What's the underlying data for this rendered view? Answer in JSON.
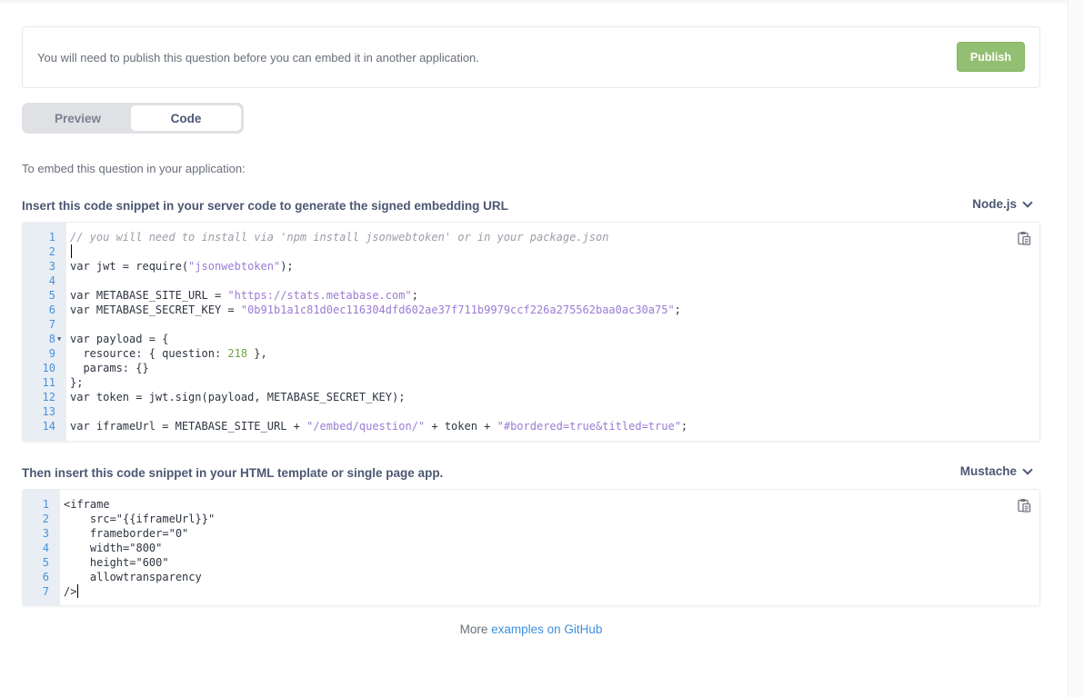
{
  "notice": {
    "text": "You will need to publish this question before you can embed it in another application.",
    "publish_label": "Publish"
  },
  "tabs": [
    {
      "label": "Preview",
      "active": false
    },
    {
      "label": "Code",
      "active": true
    }
  ],
  "embed_intro": "To embed this question in your application:",
  "server_section": {
    "label": "Insert this code snippet in your server code to generate the signed embedding URL",
    "language": "Node.js",
    "lines": [
      {
        "n": "1",
        "tokens": [
          {
            "t": "// you will need to install via 'npm install jsonwebtoken' or in your package.json",
            "c": "comment"
          }
        ]
      },
      {
        "n": "2",
        "tokens": []
      },
      {
        "n": "3",
        "tokens": [
          {
            "t": "var jwt = require(",
            "c": "plain"
          },
          {
            "t": "\"jsonwebtoken\"",
            "c": "string"
          },
          {
            "t": ");",
            "c": "plain"
          }
        ]
      },
      {
        "n": "4",
        "tokens": []
      },
      {
        "n": "5",
        "tokens": [
          {
            "t": "var METABASE_SITE_URL = ",
            "c": "plain"
          },
          {
            "t": "\"https://stats.metabase.com\"",
            "c": "string"
          },
          {
            "t": ";",
            "c": "plain"
          }
        ]
      },
      {
        "n": "6",
        "tokens": [
          {
            "t": "var METABASE_SECRET_KEY = ",
            "c": "plain"
          },
          {
            "t": "\"0b91b1a1c81d0ec116304dfd602ae37f711b9979ccf226a275562baa0ac30a75\"",
            "c": "string"
          },
          {
            "t": ";",
            "c": "plain"
          }
        ]
      },
      {
        "n": "7",
        "tokens": []
      },
      {
        "n": "8",
        "fold": true,
        "tokens": [
          {
            "t": "var payload = {",
            "c": "plain"
          }
        ]
      },
      {
        "n": "9",
        "tokens": [
          {
            "t": "  resource: { question: ",
            "c": "plain"
          },
          {
            "t": "218",
            "c": "number"
          },
          {
            "t": " },",
            "c": "plain"
          }
        ]
      },
      {
        "n": "10",
        "tokens": [
          {
            "t": "  params: {}",
            "c": "plain"
          }
        ]
      },
      {
        "n": "11",
        "tokens": [
          {
            "t": "};",
            "c": "plain"
          }
        ]
      },
      {
        "n": "12",
        "tokens": [
          {
            "t": "var token = jwt.sign(payload, METABASE_SECRET_KEY);",
            "c": "plain"
          }
        ]
      },
      {
        "n": "13",
        "tokens": []
      },
      {
        "n": "14",
        "tokens": [
          {
            "t": "var iframeUrl = METABASE_SITE_URL + ",
            "c": "plain"
          },
          {
            "t": "\"/embed/question/\"",
            "c": "string"
          },
          {
            "t": " + token + ",
            "c": "plain"
          },
          {
            "t": "\"#bordered=true&titled=true\"",
            "c": "string"
          },
          {
            "t": ";",
            "c": "plain"
          }
        ]
      }
    ]
  },
  "client_section": {
    "label": "Then insert this code snippet in your HTML template or single page app.",
    "language": "Mustache",
    "lines": [
      {
        "n": "1",
        "tokens": [
          {
            "t": "<iframe",
            "c": "plain"
          }
        ]
      },
      {
        "n": "2",
        "tokens": [
          {
            "t": "    src=\"{{iframeUrl}}\"",
            "c": "plain"
          }
        ]
      },
      {
        "n": "3",
        "tokens": [
          {
            "t": "    frameborder=\"0\"",
            "c": "plain"
          }
        ]
      },
      {
        "n": "4",
        "tokens": [
          {
            "t": "    width=\"800\"",
            "c": "plain"
          }
        ]
      },
      {
        "n": "5",
        "tokens": [
          {
            "t": "    height=\"600\"",
            "c": "plain"
          }
        ]
      },
      {
        "n": "6",
        "tokens": [
          {
            "t": "    allowtransparency",
            "c": "plain"
          }
        ]
      },
      {
        "n": "7",
        "tokens": [
          {
            "t": "/>",
            "c": "plain"
          }
        ]
      }
    ]
  },
  "footer": {
    "prefix": "More ",
    "link_text": "examples on GitHub"
  },
  "colors": {
    "publish": "#93bf72",
    "link": "#3e8fdc",
    "code_string": "#9b7bd4",
    "code_number": "#6ea441",
    "line_number": "#4a90d9"
  }
}
